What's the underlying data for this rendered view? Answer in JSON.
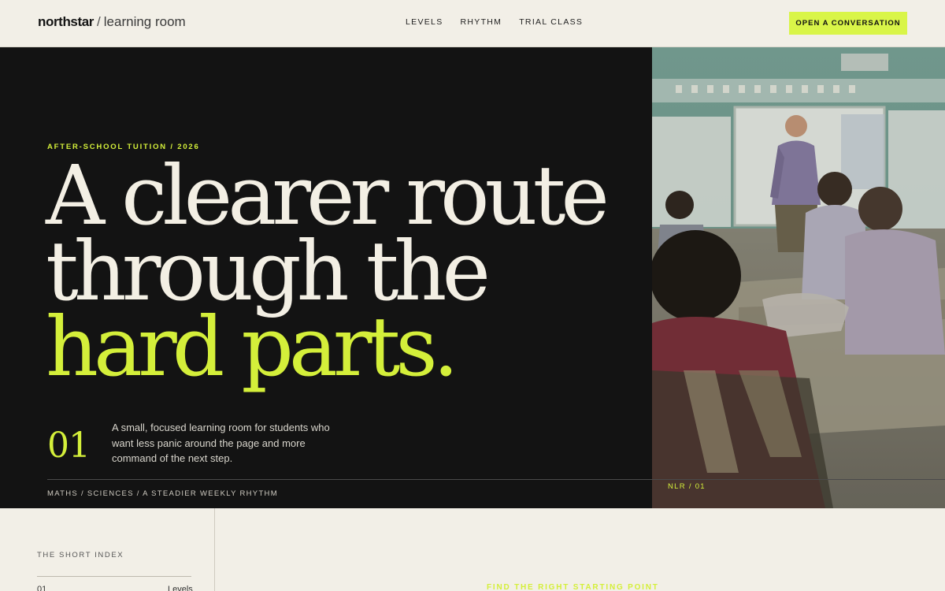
{
  "header": {
    "brand_strong": "northstar",
    "brand_sep": "/",
    "brand_light": "learning room",
    "nav": [
      "LEVELS",
      "RHYTHM",
      "TRIAL CLASS"
    ],
    "cta_label": "OPEN A CONVERSATION"
  },
  "hero": {
    "eyebrow": "AFTER-SCHOOL TUITION / 2026",
    "headline_line1": "A clearer route",
    "headline_line2": "through the",
    "headline_line3": "hard parts.",
    "number": "01",
    "description": "A small, focused learning room for students who want less panic around the page and more command of the next step.",
    "footer": "MATHS / SCIENCES / A STEADIER WEEKLY RHYTHM",
    "photo_tag": "NLR / 01"
  },
  "index": {
    "title": "THE SHORT INDEX",
    "items": [
      {
        "num": "01",
        "label": "Levels"
      }
    ]
  },
  "section": {
    "eyebrow": "FIND THE RIGHT STARTING POINT"
  },
  "colors": {
    "accent": "#d4ef3a",
    "cta": "#d9f548",
    "dark": "#131313",
    "paper": "#f2efe7"
  }
}
